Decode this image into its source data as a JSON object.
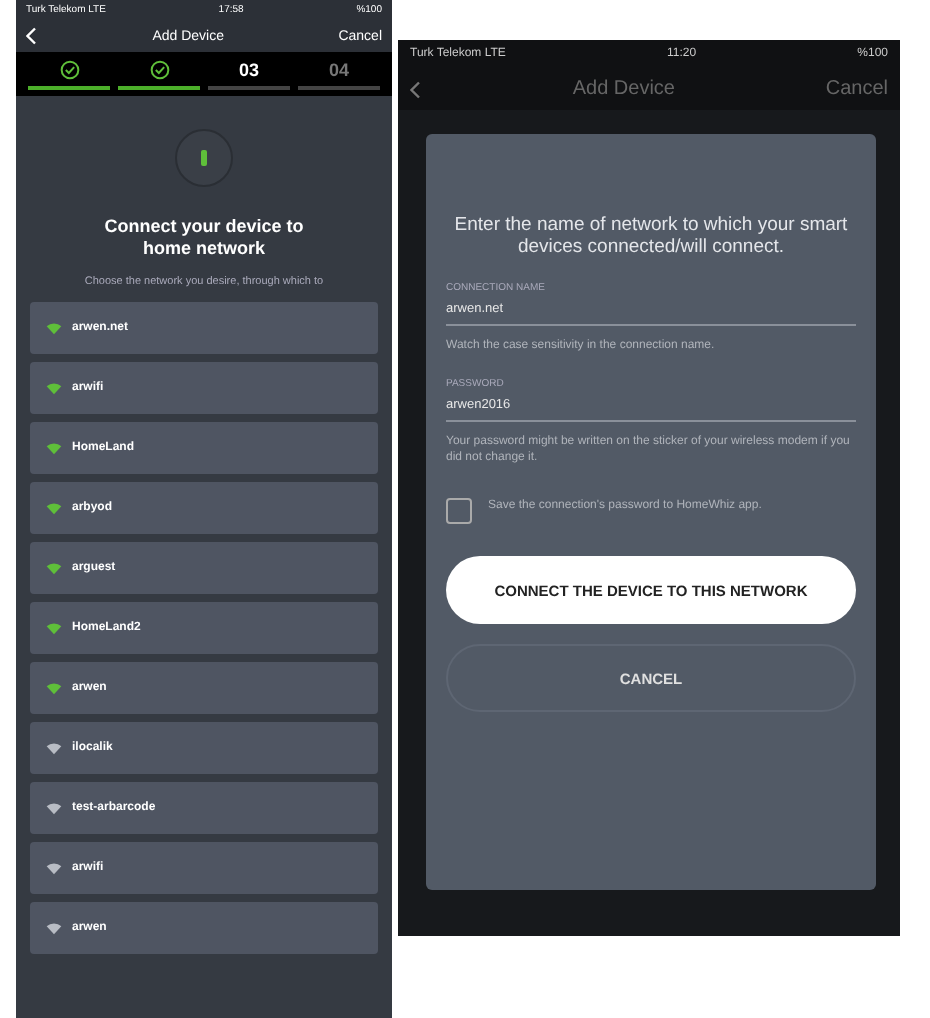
{
  "left_screen": {
    "status_bar": {
      "carrier": "Turk Telekom  LTE",
      "time": "17:58",
      "battery": "%100"
    },
    "nav": {
      "title": "Add Device",
      "action": "Cancel"
    },
    "steps": [
      {
        "done": true
      },
      {
        "done": true
      },
      {
        "number": "03",
        "done": false
      },
      {
        "number": "04",
        "done": false
      }
    ],
    "heading": "Connect your device to home network",
    "description": "Choose the network you desire, through which to",
    "networks": [
      {
        "name": "arwen.net",
        "color": "#5fbf3a"
      },
      {
        "name": "arwifi",
        "color": "#5fbf3a"
      },
      {
        "name": "HomeLand",
        "color": "#5fbf3a"
      },
      {
        "name": "arbyod",
        "color": "#5fbf3a"
      },
      {
        "name": "arguest",
        "color": "#5fbf3a"
      },
      {
        "name": "HomeLand2",
        "color": "#5fbf3a"
      },
      {
        "name": "arwen",
        "color": "#5fbf3a"
      },
      {
        "name": "ilocalik",
        "color": "#b8bcc4"
      },
      {
        "name": "test-arbarcode",
        "color": "#b8bcc4"
      },
      {
        "name": "arwifi",
        "color": "#b8bcc4"
      },
      {
        "name": "arwen",
        "color": "#b8bcc4"
      }
    ]
  },
  "right_screen": {
    "status_bar": {
      "carrier": "Turk Telekom  LTE",
      "time": "11:20",
      "battery": "%100"
    },
    "nav": {
      "title": "Add Device",
      "action": "Cancel"
    },
    "dialog": {
      "title": "Enter the name of network to which your smart devices connected/will connect.",
      "connection_label": "CONNECTION NAME",
      "connection_value": "arwen.net",
      "connection_hint": "Watch the case sensitivity in the connection name.",
      "password_label": "PASSWORD",
      "password_value": "arwen2016",
      "password_hint": "Your password might be written on the sticker of your wireless modem if you did not change it.",
      "save_password": {
        "label": "Save the connection's password to HomeWhiz app.",
        "checked": false
      },
      "buttons": [
        {
          "label": "CONNECT THE DEVICE TO THIS NETWORK",
          "kind": "primary"
        },
        {
          "label": "CANCEL",
          "kind": "secondary"
        }
      ]
    }
  }
}
